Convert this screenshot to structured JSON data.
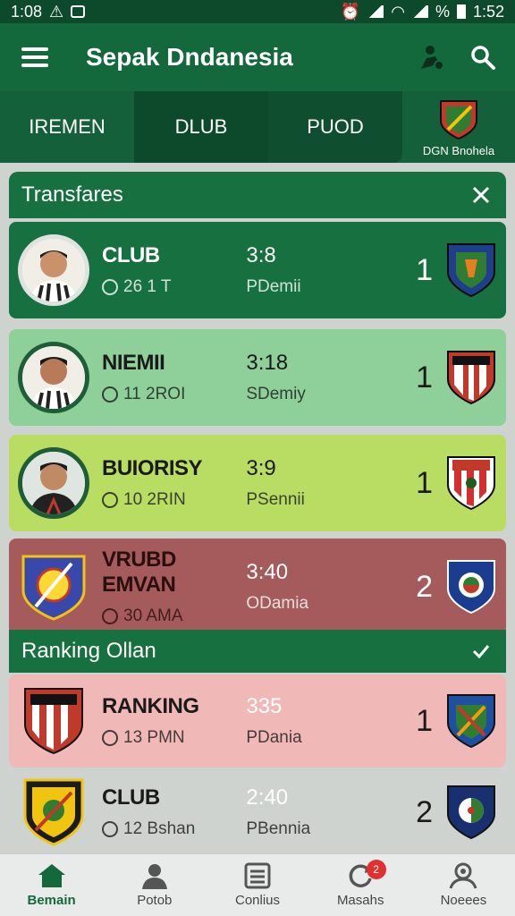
{
  "status_bar": {
    "time_left": "1:08",
    "time_right": "1:52"
  },
  "app_bar": {
    "title": "Sepak Dndanesia"
  },
  "tabs": [
    {
      "label": "IREMEN"
    },
    {
      "label": "DLUB"
    },
    {
      "label": "PUOD"
    }
  ],
  "tab_logo_caption": "DGN Bnohela",
  "transfers": {
    "title": "Transfares",
    "items": [
      {
        "name": "CLUB",
        "sub": "26 1 T",
        "score": "3:8",
        "club": "PDemii",
        "rank": "1",
        "bg": "#17703f",
        "fg": "#ffffff"
      },
      {
        "name": "NIEMII",
        "sub": "11 2ROI",
        "score": "3:18",
        "club": "SDemiy",
        "rank": "1",
        "bg": "#8fd09a",
        "fg": "#1a1a1a"
      },
      {
        "name": "BUIORISY",
        "sub": "10 2RIN",
        "score": "3:9",
        "club": "PSennii",
        "rank": "1",
        "bg": "#b9dc63",
        "fg": "#1a1a1a"
      },
      {
        "name": "VRUBD EMVAN",
        "sub": "30 AMA",
        "score": "3:40",
        "club": "ODamia",
        "rank": "2",
        "bg": "#a55a5b",
        "fg": "#2a0f0f"
      }
    ]
  },
  "ranking": {
    "title": "Ranking Ollan",
    "items": [
      {
        "name": "RANKING",
        "sub": "13 PMN",
        "score": "335",
        "club": "PDania",
        "rank": "1",
        "bg": "#f0b9b8",
        "fg": "#1a1a1a"
      },
      {
        "name": "CLUB",
        "sub": "12 Bshan",
        "score": "2:40",
        "club": "PBennia",
        "rank": "2",
        "bg": "#cfd3d0",
        "fg": "#1a1a1a"
      }
    ]
  },
  "bottom_nav": [
    {
      "label": "Bemain",
      "icon": "home-icon"
    },
    {
      "label": "Potob",
      "icon": "person-icon"
    },
    {
      "label": "Conlius",
      "icon": "list-icon"
    },
    {
      "label": "Masahs",
      "icon": "refresh-icon",
      "badge": "2"
    },
    {
      "label": "Noeees",
      "icon": "profile-icon"
    }
  ],
  "colors": {
    "primary": "#13683c",
    "dark": "#0c4a2b"
  }
}
